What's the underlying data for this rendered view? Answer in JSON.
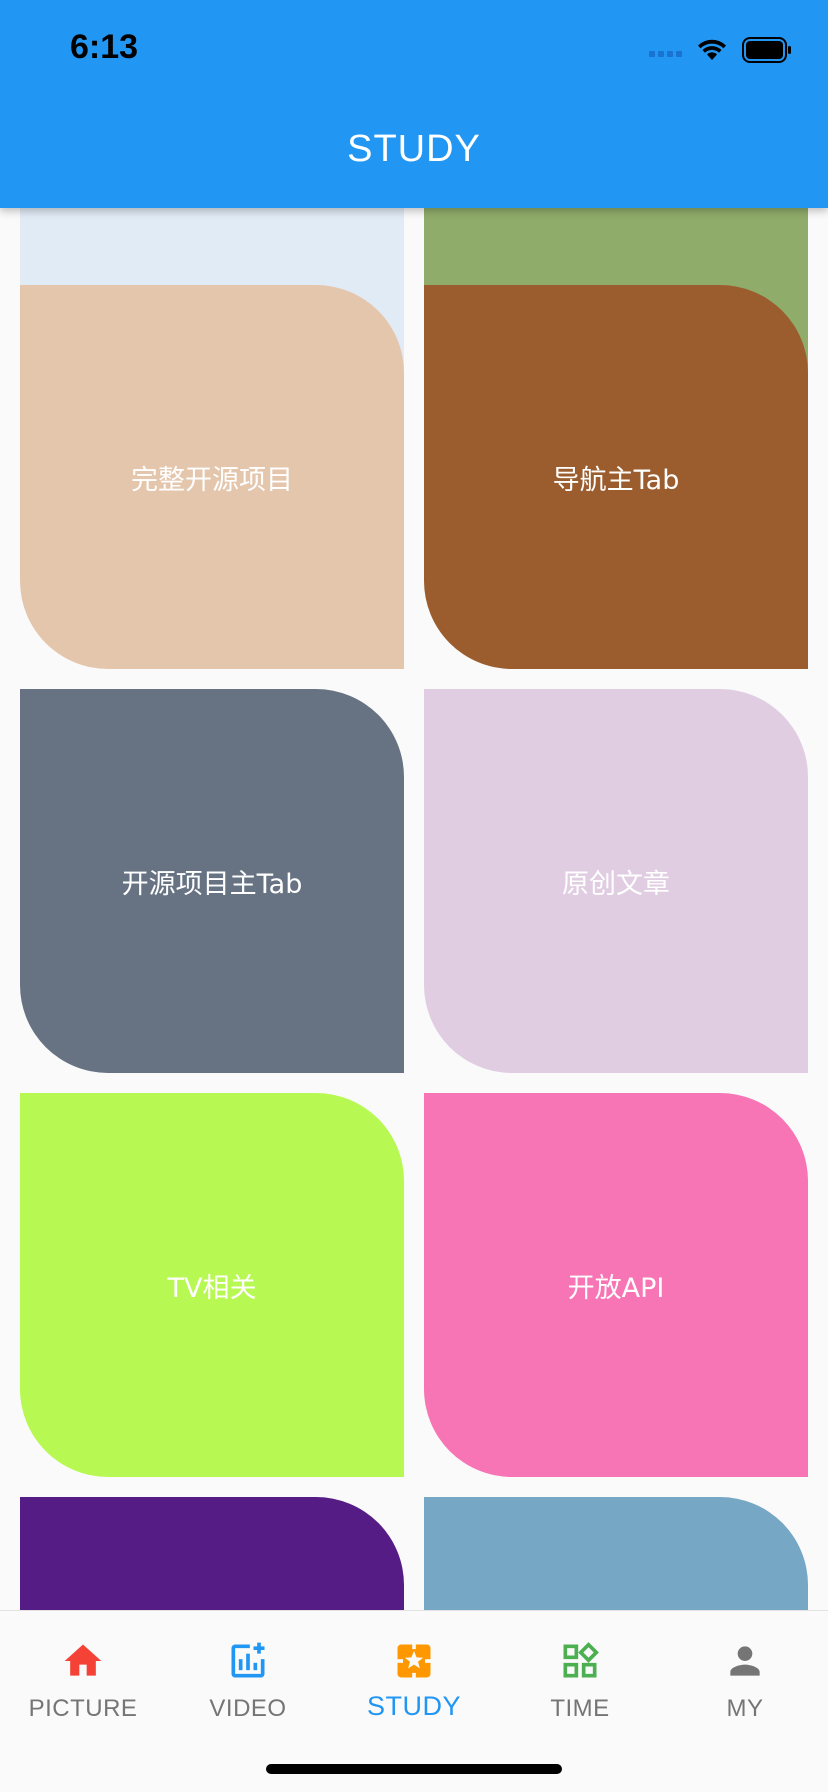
{
  "status_bar": {
    "time": "6:13"
  },
  "app_bar": {
    "title": "STUDY"
  },
  "grid": {
    "tiles": [
      {
        "label": "",
        "color": "#E1EBF5"
      },
      {
        "label": "",
        "color": "#8FAC6A"
      },
      {
        "label": "完整开源项目",
        "color": "#E4C6AD"
      },
      {
        "label": "导航主Tab",
        "color": "#9B5D2D"
      },
      {
        "label": "开源项目主Tab",
        "color": "#677383"
      },
      {
        "label": "原创文章",
        "color": "#E0CDE2"
      },
      {
        "label": "TV相关",
        "color": "#B8F852"
      },
      {
        "label": "开放API",
        "color": "#F875B5"
      },
      {
        "label": "",
        "color": "#551C85"
      },
      {
        "label": "",
        "color": "#76A7C5"
      }
    ]
  },
  "bottom_nav": {
    "items": [
      {
        "label": "PICTURE",
        "icon": "home-icon",
        "color": "#F44336"
      },
      {
        "label": "VIDEO",
        "icon": "chart-add-icon",
        "color": "#2196F3"
      },
      {
        "label": "STUDY",
        "icon": "study-icon",
        "color": "#FF9800",
        "active": true
      },
      {
        "label": "TIME",
        "icon": "widgets-icon",
        "color": "#4CAF50"
      },
      {
        "label": "MY",
        "icon": "person-icon",
        "color": "#757575"
      }
    ],
    "active_color": "#2196F3"
  }
}
